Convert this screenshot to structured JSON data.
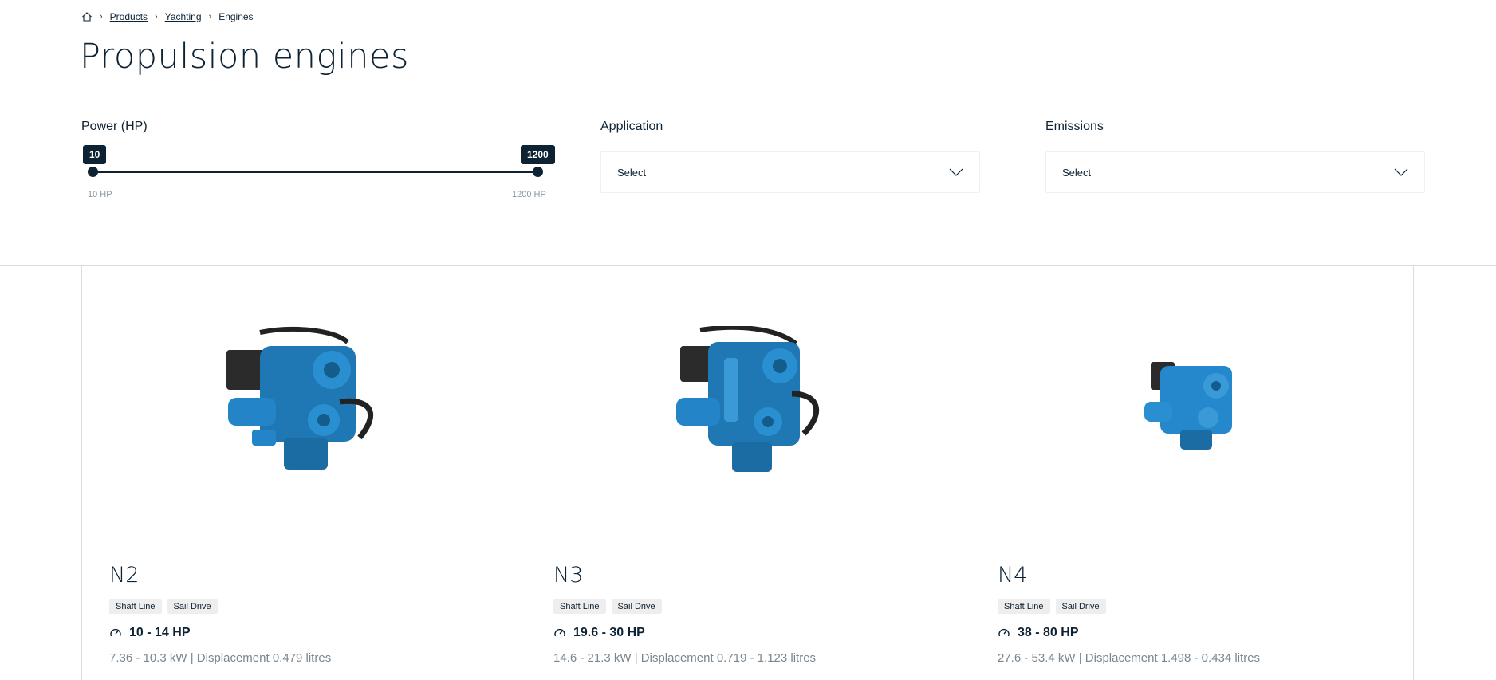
{
  "breadcrumb": {
    "home_icon": "home-icon",
    "items": [
      "Products",
      "Yachting"
    ],
    "current": "Engines"
  },
  "page_title": "Propulsion engines",
  "filters": {
    "power": {
      "label": "Power (HP)",
      "min_value": "10",
      "max_value": "1200",
      "min_label": "10 HP",
      "max_label": "1200 HP"
    },
    "application": {
      "label": "Application",
      "value": "Select"
    },
    "emissions": {
      "label": "Emissions",
      "value": "Select"
    }
  },
  "colors": {
    "primary": "#0d2233",
    "engine_blue": "#1f78b4",
    "muted": "#7a8690",
    "tag_bg": "#eeeeee",
    "border": "#dcdcdc"
  },
  "products": [
    {
      "name": "N2",
      "tags": [
        "Shaft Line",
        "Sail Drive"
      ],
      "power": "10 - 14 HP",
      "specs": "7.36 - 10.3 kW | Displacement 0.479 litres"
    },
    {
      "name": "N3",
      "tags": [
        "Shaft Line",
        "Sail Drive"
      ],
      "power": "19.6 - 30 HP",
      "specs": "14.6 - 21.3 kW | Displacement 0.719 - 1.123 litres"
    },
    {
      "name": "N4",
      "tags": [
        "Shaft Line",
        "Sail Drive"
      ],
      "power": "38 - 80 HP",
      "specs": "27.6 - 53.4 kW | Displacement 1.498 - 0.434 litres"
    }
  ]
}
